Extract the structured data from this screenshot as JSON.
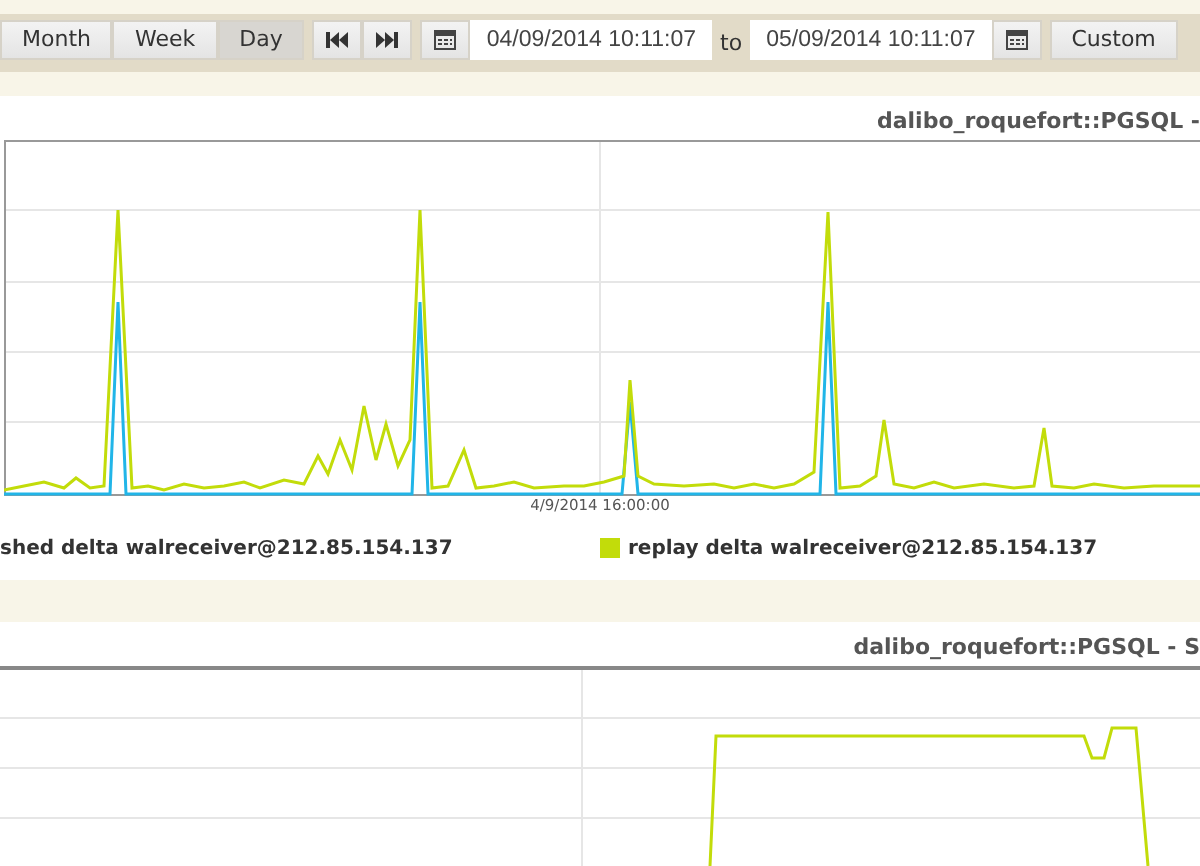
{
  "toolbar": {
    "range_buttons": [
      {
        "label": "Month",
        "selected": false
      },
      {
        "label": "Week",
        "selected": false
      },
      {
        "label": "Day",
        "selected": true
      }
    ],
    "date_from": "04/09/2014 10:11:07",
    "separator": "to",
    "date_to": "05/09/2014 10:11:07",
    "custom_button": "Custom"
  },
  "charts": [
    {
      "kind": "spikes",
      "title": "dalibo_roquefort::PGSQL -",
      "x_tick_label": "4/9/2014 16:00:00",
      "legend": [
        {
          "label": "shed delta walreceiver@212.85.154.137",
          "color": "#21b5e8"
        },
        {
          "label": "replay delta walreceiver@212.85.154.137",
          "color": "#c2dc0a"
        }
      ]
    },
    {
      "kind": "plateau",
      "title": "dalibo_roquefort::PGSQL - S",
      "color": "#c2dc0a"
    }
  ]
}
